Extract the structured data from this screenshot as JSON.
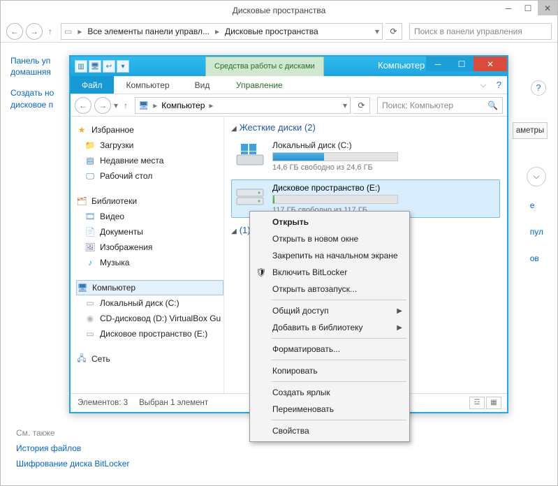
{
  "cp": {
    "title": "Дисковые пространства",
    "crumb1": "Все элементы панели управл...",
    "crumb2": "Дисковые пространства",
    "search_ph": "Поиск в панели управления",
    "left_link1": "Панель уп",
    "left_link2": "домашняя",
    "left_link3": "Создать но",
    "left_link4": "дисковое п",
    "btn_params": "аметры",
    "rlink1": "е",
    "rlink2": "пул",
    "rlink3": "ов",
    "footer_head": "См. также",
    "footer1": "История файлов",
    "footer2": "Шифрование диска BitLocker"
  },
  "ex": {
    "ctx_tab": "Средства работы с дисками",
    "title": "Компьютер",
    "tab_file": "Файл",
    "tab_computer": "Компьютер",
    "tab_view": "Вид",
    "tab_manage": "Управление",
    "crumb1": "Компьютер",
    "search_ph": "Поиск: Компьютер",
    "tree": {
      "fav": "Избранное",
      "downloads": "Загрузки",
      "recent": "Недавние места",
      "desktop": "Рабочий стол",
      "libs": "Библиотеки",
      "video": "Видео",
      "docs": "Документы",
      "images": "Изображения",
      "music": "Музыка",
      "computer": "Компьютер",
      "localc": "Локальный диск (C:)",
      "cdd": "CD-дисковод (D:) VirtualBox Gu",
      "spacee": "Дисковое пространство (E:)",
      "network": "Сеть"
    },
    "content": {
      "hdd_group": "Жесткие диски (2)",
      "c_title": "Локальный диск (C:)",
      "c_stat": "14,6 ГБ свободно из 24,6 ГБ",
      "e_title": "Дисковое пространство (E:)",
      "e_stat": "117 ГБ свободно из 117 ГБ",
      "rem_group": "(1)"
    },
    "status_items": "Элементов: 3",
    "status_sel": "Выбран 1 элемент"
  },
  "ctx": {
    "open": "Открыть",
    "open_new": "Открыть в новом окне",
    "pin": "Закрепить на начальном экране",
    "bitlocker": "Включить BitLocker",
    "autoplay": "Открыть автозапуск...",
    "share": "Общий доступ",
    "addlib": "Добавить в библиотеку",
    "format": "Форматировать...",
    "copy": "Копировать",
    "shortcut": "Создать ярлык",
    "rename": "Переименовать",
    "props": "Свойства"
  }
}
